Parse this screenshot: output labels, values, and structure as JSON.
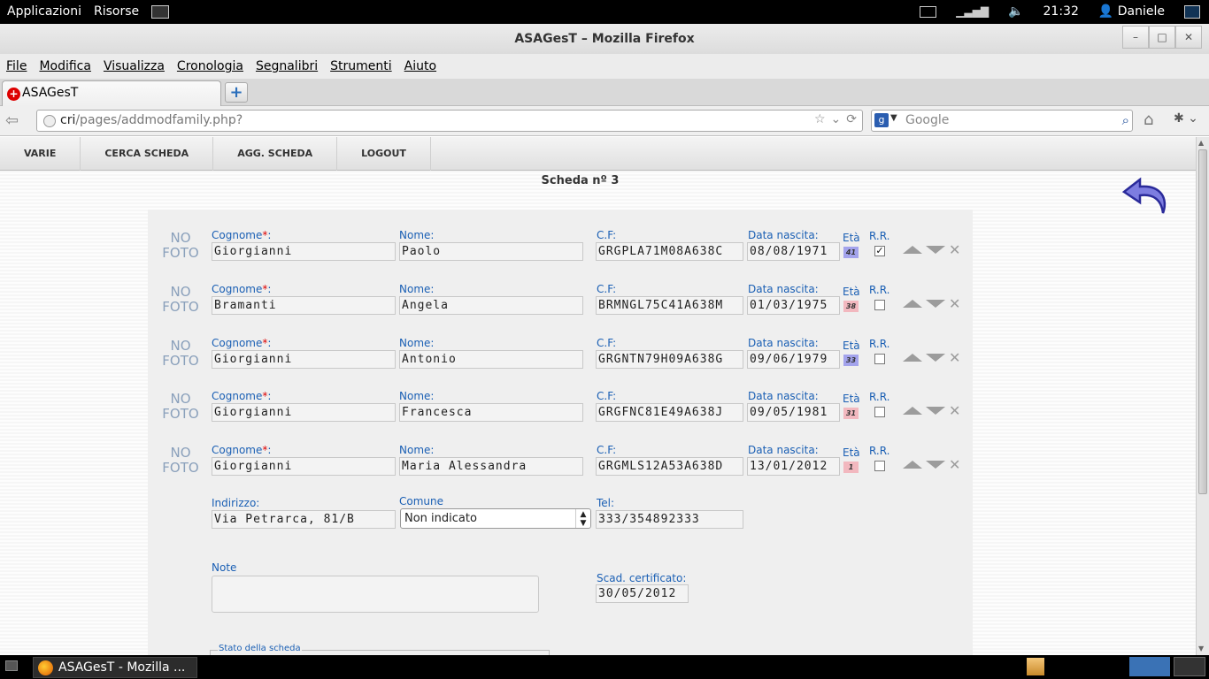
{
  "system_bar": {
    "apps_label": "Applicazioni",
    "places_label": "Risorse",
    "clock": "21:32",
    "user": "Daniele"
  },
  "window": {
    "title": "ASAGesT – Mozilla Firefox"
  },
  "menu": [
    "File",
    "Modifica",
    "Visualizza",
    "Cronologia",
    "Segnalibri",
    "Strumenti",
    "Aiuto"
  ],
  "tab": {
    "label": "ASAGesT"
  },
  "address_bar": {
    "host": "cri",
    "path": "/pages/addmodfamily.php?"
  },
  "search_box": {
    "placeholder": "Google"
  },
  "app_nav": [
    "VARIE",
    "CERCA SCHEDA",
    "AGG. SCHEDA",
    "LOGOUT"
  ],
  "page": {
    "title": "Scheda nº 3"
  },
  "labels": {
    "no_foto_1": "NO",
    "no_foto_2": "FOTO",
    "cognome": "Cognome",
    "required": "*",
    "colon": ":",
    "nome": "Nome:",
    "cf": "C.F:",
    "data_nascita": "Data nascita:",
    "eta": "Età",
    "rr": "R.R.",
    "indirizzo": "Indirizzo:",
    "comune": "Comune",
    "tel": "Tel:",
    "note": "Note",
    "scad_cert": "Scad. certificato:",
    "stato": "Stato della scheda"
  },
  "members": [
    {
      "cognome": "Giorgianni",
      "nome": "Paolo",
      "cf": "GRGPLA71M08A638C",
      "data_nascita": "08/08/1971",
      "eta": "41",
      "eta_color": "blue",
      "rr": true
    },
    {
      "cognome": "Bramanti",
      "nome": "Angela",
      "cf": "BRMNGL75C41A638M",
      "data_nascita": "01/03/1975",
      "eta": "38",
      "eta_color": "pink",
      "rr": false
    },
    {
      "cognome": "Giorgianni",
      "nome": "Antonio",
      "cf": "GRGNTN79H09A638G",
      "data_nascita": "09/06/1979",
      "eta": "33",
      "eta_color": "blue",
      "rr": false
    },
    {
      "cognome": "Giorgianni",
      "nome": "Francesca",
      "cf": "GRGFNC81E49A638J",
      "data_nascita": "09/05/1981",
      "eta": "31",
      "eta_color": "pink",
      "rr": false
    },
    {
      "cognome": "Giorgianni",
      "nome": "Maria Alessandra",
      "cf": "GRGMLS12A53A638D",
      "data_nascita": "13/01/2012",
      "eta": "1",
      "eta_color": "pink",
      "rr": false
    }
  ],
  "address": {
    "indirizzo": "Via Petrarca, 81/B",
    "comune": "Non indicato",
    "tel": "333/354892333"
  },
  "note_value": "",
  "scad_certificato": "30/05/2012",
  "taskbar": {
    "item": "ASAGesT - Mozilla ..."
  },
  "colors": {
    "label_blue": "#1a5fb4",
    "age_blue": "#a3a3ec",
    "age_pink": "#f2b8bf",
    "required_red": "#dd0000"
  }
}
